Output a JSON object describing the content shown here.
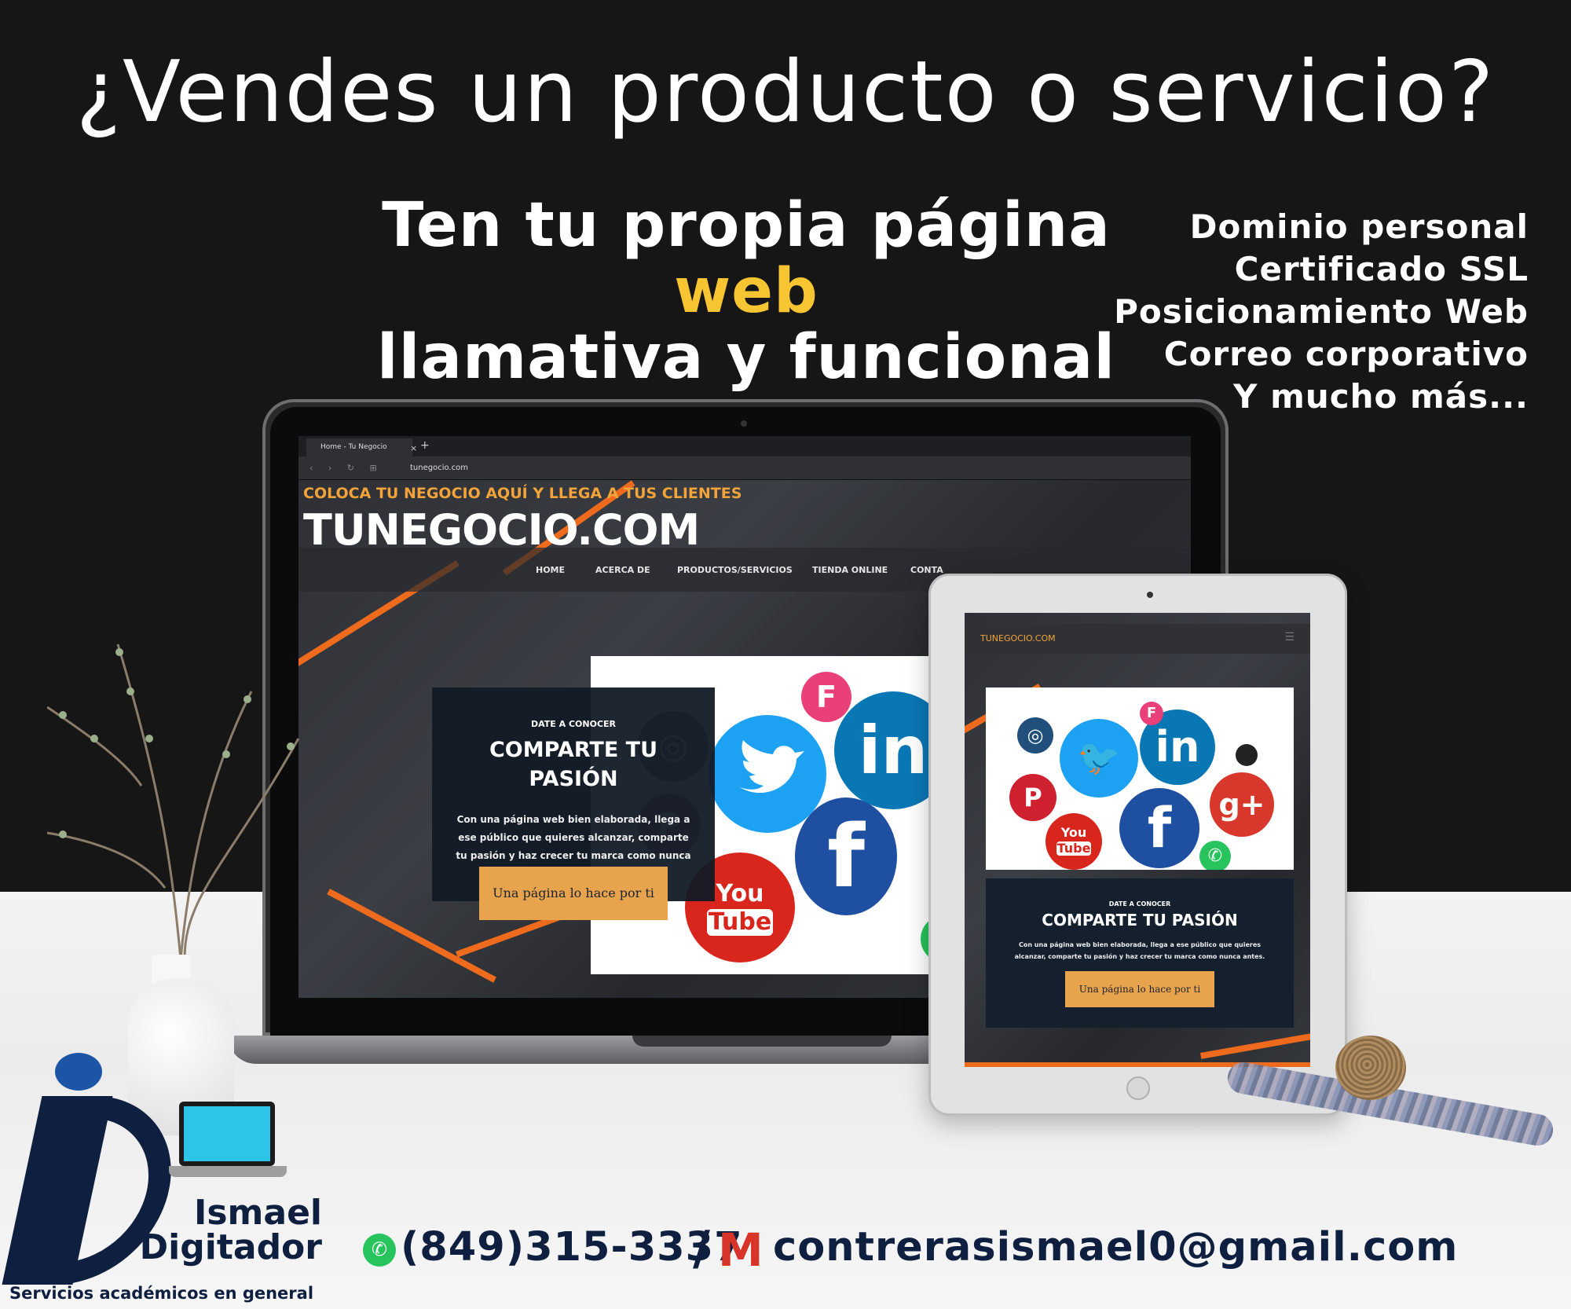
{
  "headline": "¿Vendes un producto o servicio?",
  "tagline": {
    "line1_prefix": "Ten tu propia página ",
    "line1_highlight": "web",
    "line2": "llamativa y funcional"
  },
  "features": [
    "Dominio personal",
    "Certificado SSL",
    "Posicionamiento Web",
    "Correo corporativo",
    "Y mucho más..."
  ],
  "colors": {
    "highlight": "#f7c531",
    "accent_orange": "#ee6b1d",
    "button": "#e7a44d",
    "brand_navy": "#0e1f3f"
  },
  "laptop": {
    "tab_title": "Home - Tu Negocio",
    "url": "tunegocio.com",
    "site_tagline": "COLOCA TU NEGOCIO AQUÍ Y LLEGA A TUS CLIENTES",
    "site_brand": "TUNEGOCIO.COM",
    "nav": [
      "HOME",
      "ACERCA DE",
      "PRODUCTOS/SERVICIOS",
      "TIENDA ONLINE",
      "CONTA"
    ],
    "promo_kicker": "DATE A CONOCER",
    "promo_title": "COMPARTE TU PASIÓN",
    "promo_body": "Con una página web bien elaborada, llega a ese público que quieres alcanzar, comparte tu pasión y haz crecer tu marca como nunca antes.",
    "promo_button": "Una página lo hace por ti"
  },
  "tablet": {
    "brand": "TUNEGOCIO.COM",
    "kicker": "DATE A CONOCER",
    "title": "COMPARTE TU PASIÓN",
    "body": "Con una página web bien elaborada, llega a ese público que quieres alcanzar, comparte tu pasión y haz crecer tu marca como nunca antes.",
    "button": "Una página lo hace por ti"
  },
  "social_icons": [
    "foursquare-icon",
    "twitter-icon",
    "linkedin-icon",
    "facebook-icon",
    "youtube-icon",
    "instagram-icon",
    "pinterest-icon",
    "google-plus-icon",
    "whatsapp-icon"
  ],
  "social_glyphs": {
    "youtube_top": "You",
    "youtube_bottom": "Tube",
    "linkedin": "in",
    "facebook": "f",
    "google_plus": "g+"
  },
  "brand": {
    "name_line1": "Ismael",
    "name_line2": "Digitador",
    "subtitle": "Servicios académicos en general"
  },
  "contact": {
    "phone": "(849)315-3337",
    "separator": "/",
    "email": "contrerasismael0@gmail.com"
  }
}
